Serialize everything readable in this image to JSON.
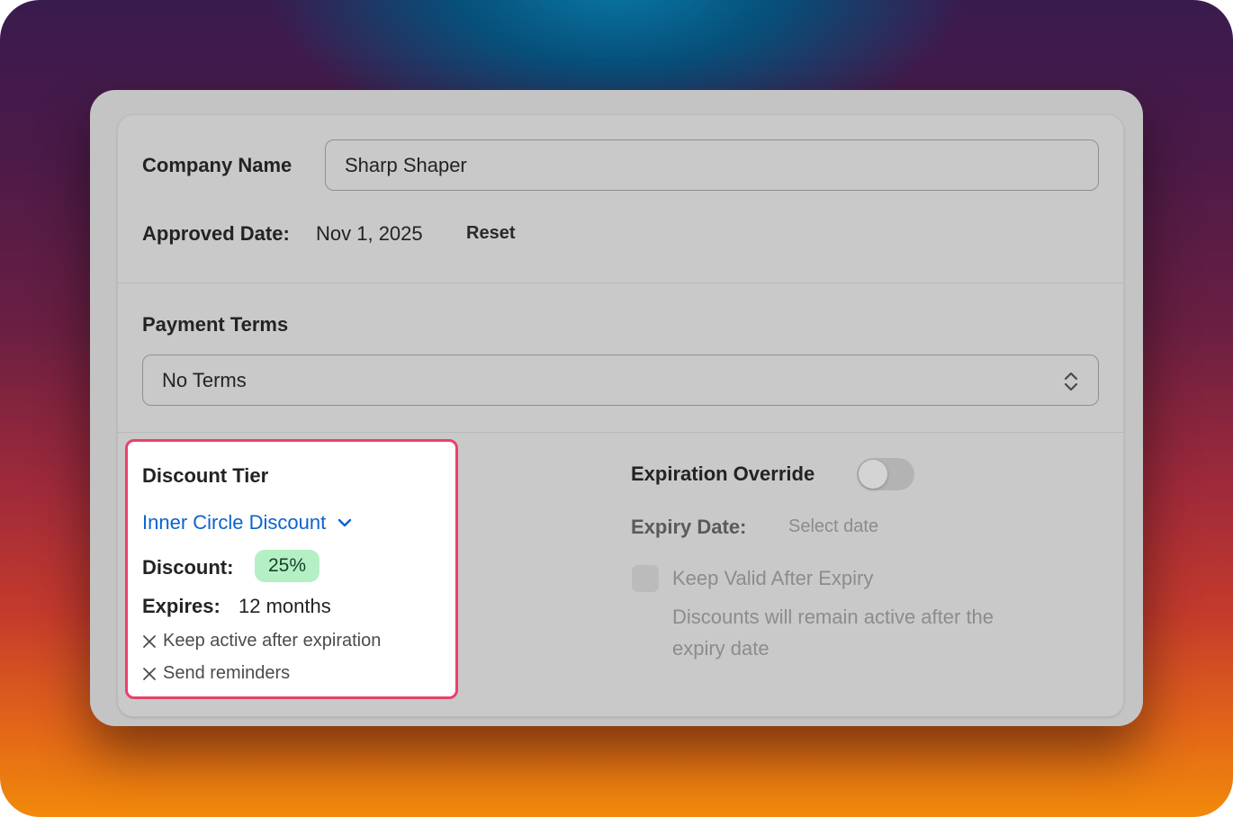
{
  "company": {
    "label": "Company Name",
    "value": "Sharp Shaper"
  },
  "approved": {
    "label": "Approved Date:",
    "value": "Nov 1, 2025",
    "reset_label": "Reset"
  },
  "payment_terms": {
    "label": "Payment Terms",
    "selected": "No Terms",
    "icon": "up-down-chevron-icon"
  },
  "discount_tier": {
    "title": "Discount Tier",
    "selected": "Inner Circle Discount",
    "dropdown_icon": "chevron-down-icon",
    "discount_label": "Discount:",
    "discount_value": "25%",
    "expires_label": "Expires:",
    "expires_value": "12 months",
    "options": [
      {
        "icon": "x-icon",
        "text": "Keep active after expiration"
      },
      {
        "icon": "x-icon",
        "text": "Send reminders"
      }
    ],
    "highlight_color": "#e8416a"
  },
  "expiration_override": {
    "label": "Expiration Override",
    "toggle_on": false,
    "expiry_label": "Expiry Date:",
    "expiry_placeholder": "Select date",
    "keep_valid_label": "Keep Valid After Expiry",
    "keep_valid_checked": false,
    "description_line1": "Discounts will remain active after the",
    "description_line2": "expiry date"
  },
  "colors": {
    "link": "#0b63ce",
    "badge_bg": "#b5f0c4"
  }
}
